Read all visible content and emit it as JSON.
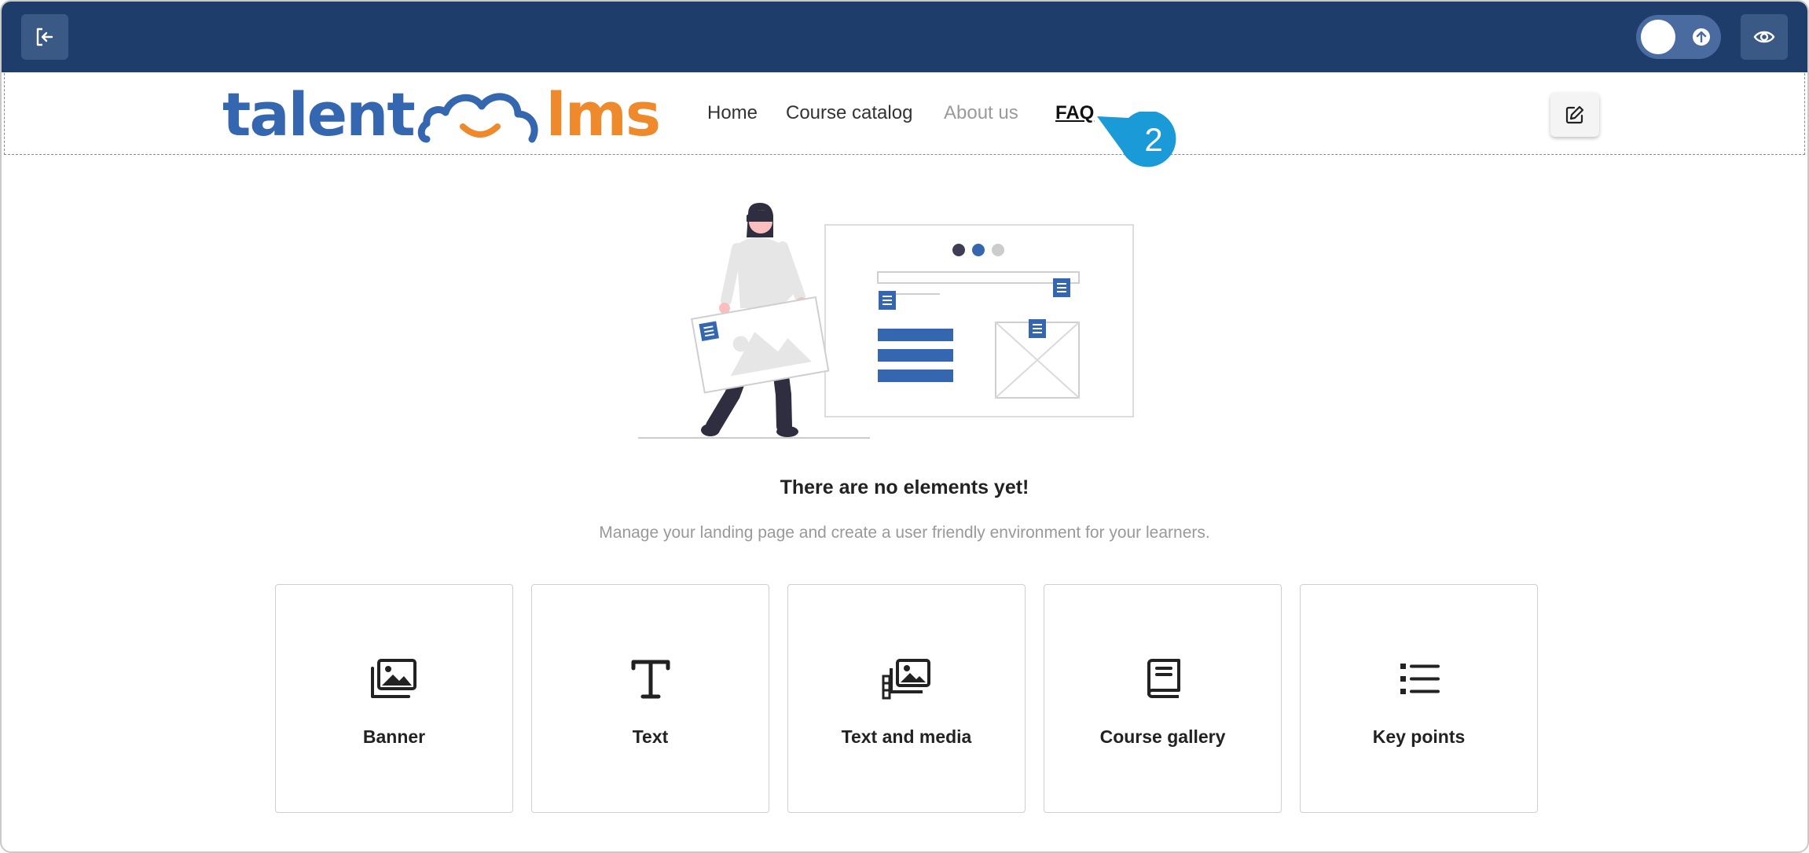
{
  "logo": {
    "part1": "talent",
    "part2": "lms"
  },
  "nav": {
    "home": "Home",
    "catalog": "Course catalog",
    "about": "About us",
    "faq": "FAQ"
  },
  "callout": {
    "number": "2"
  },
  "empty_state": {
    "title": "There are no elements yet!",
    "subtitle": "Manage your landing page and create a user friendly environment for your learners."
  },
  "cards": [
    {
      "label": "Banner",
      "icon": "images-icon"
    },
    {
      "label": "Text",
      "icon": "text-icon"
    },
    {
      "label": "Text and media",
      "icon": "text-media-icon"
    },
    {
      "label": "Course gallery",
      "icon": "book-icon"
    },
    {
      "label": "Key points",
      "icon": "list-icon"
    }
  ],
  "colors": {
    "topbar": "#1f3d6b",
    "brand_blue": "#3566b0",
    "brand_orange": "#ef8a2c",
    "callout": "#1a9ad6"
  }
}
